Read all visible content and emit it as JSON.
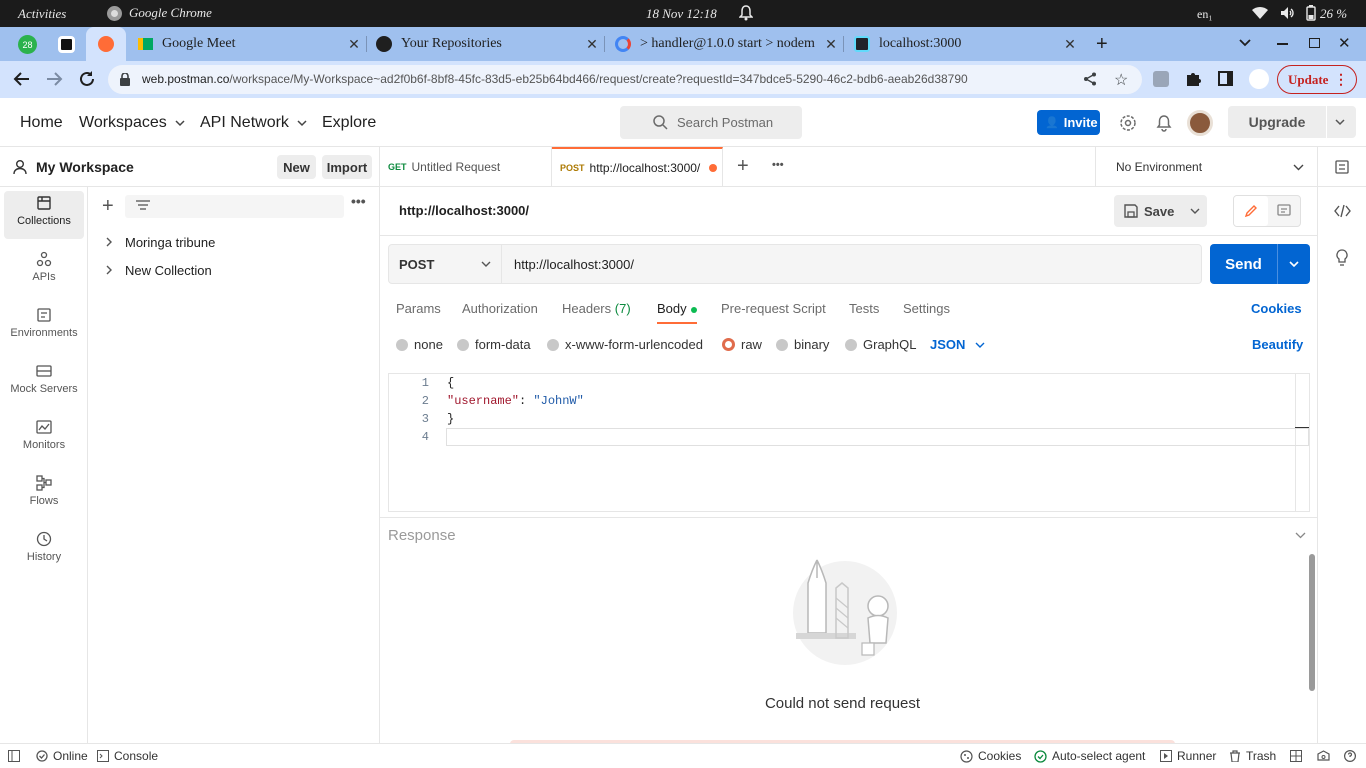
{
  "os": {
    "activities": "Activities",
    "app": "Google Chrome",
    "datetime": "18 Nov  12:18",
    "lang": "en₁",
    "battery": "26 %"
  },
  "chrome": {
    "tabs": [
      {
        "title": "Google Meet"
      },
      {
        "title": "Your Repositories"
      },
      {
        "title": "> handler@1.0.0 start > nodem"
      },
      {
        "title": "localhost:3000"
      }
    ],
    "pinned_badge": "28",
    "url_host": "web.postman.co",
    "url_path": "/workspace/My-Workspace~ad2f0b6f-8bf8-45fc-83d5-eb25b64bd466/request/create?requestId=347bdce5-5290-46c2-bdb6-aeab26d38790",
    "update_label": "Update"
  },
  "postman": {
    "nav": {
      "home": "Home",
      "workspaces": "Workspaces",
      "api_network": "API Network",
      "explore": "Explore"
    },
    "search_placeholder": "Search Postman",
    "invite": "Invite",
    "upgrade": "Upgrade",
    "workspace_name": "My Workspace",
    "new_label": "New",
    "import_label": "Import",
    "rail": [
      {
        "label": "Collections",
        "icon": "collections-icon"
      },
      {
        "label": "APIs",
        "icon": "apis-icon"
      },
      {
        "label": "Environments",
        "icon": "environments-icon"
      },
      {
        "label": "Mock Servers",
        "icon": "mock-servers-icon"
      },
      {
        "label": "Monitors",
        "icon": "monitors-icon"
      },
      {
        "label": "Flows",
        "icon": "flows-icon"
      },
      {
        "label": "History",
        "icon": "history-icon"
      }
    ],
    "collections": [
      {
        "name": "Moringa tribune"
      },
      {
        "name": "New Collection"
      }
    ],
    "request_tabs": [
      {
        "method": "GET",
        "title": "Untitled Request"
      },
      {
        "method": "POST",
        "title": "http://localhost:3000/"
      }
    ],
    "environment": "No Environment",
    "request_name": "http://localhost:3000/",
    "save_label": "Save",
    "method": "POST",
    "url": "http://localhost:3000/",
    "send_label": "Send",
    "req_tabs": {
      "params": "Params",
      "authorization": "Authorization",
      "headers": "Headers",
      "headers_count": "(7)",
      "body": "Body",
      "prerequest": "Pre-request Script",
      "tests": "Tests",
      "settings": "Settings",
      "cookies": "Cookies"
    },
    "body_types": {
      "none": "none",
      "form_data": "form-data",
      "urlencoded": "x-www-form-urlencoded",
      "raw": "raw",
      "binary": "binary",
      "graphql": "GraphQL",
      "json": "JSON",
      "beautify": "Beautify"
    },
    "code_lines": [
      {
        "n": "1",
        "text": "{"
      },
      {
        "n": "2",
        "key": "\"username\"",
        "sep": ": ",
        "value": "\"JohnW\""
      },
      {
        "n": "3",
        "text": "}"
      },
      {
        "n": "4",
        "text": ""
      }
    ],
    "response_label": "Response",
    "response_message": "Could not send request",
    "status": {
      "online": "Online",
      "console": "Console",
      "cookies": "Cookies",
      "agent": "Auto-select agent",
      "runner": "Runner",
      "trash": "Trash"
    }
  },
  "colors": {
    "accent": "#ff6c37",
    "send_blue": "#0265d2",
    "update_red": "#c5221f"
  }
}
